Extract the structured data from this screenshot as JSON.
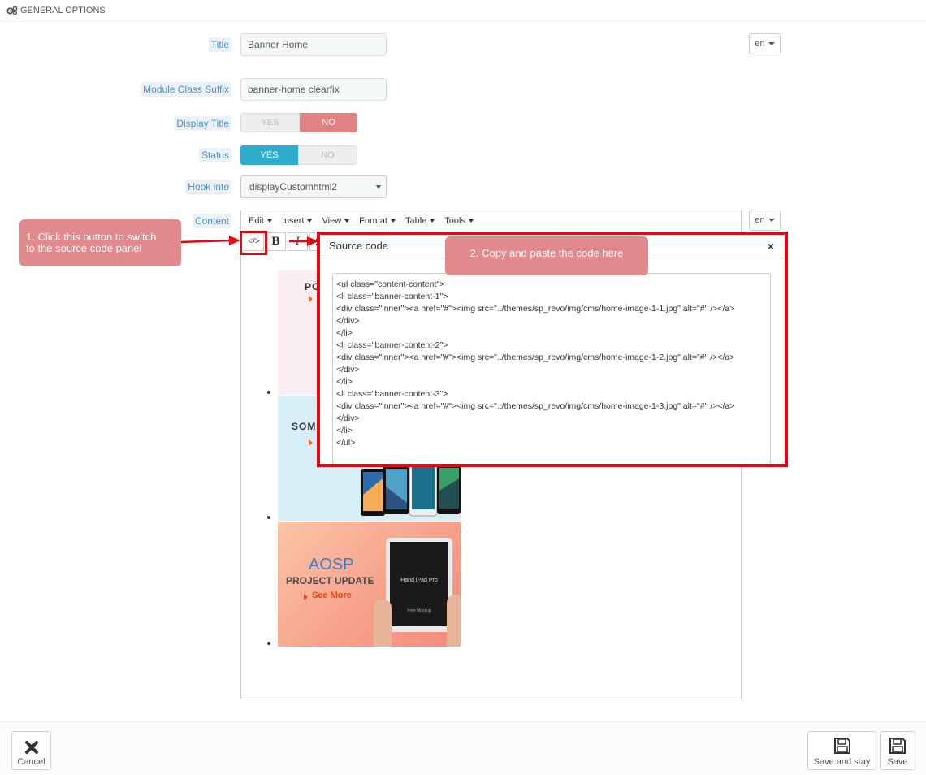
{
  "header": {
    "title": "GENERAL OPTIONS"
  },
  "form": {
    "title_label": "Title",
    "title_value": "Banner Home",
    "lang": "en",
    "suffix_label": "Module Class Suffix",
    "suffix_value": "banner-home clearfix",
    "display_title_label": "Display Title",
    "display_title_yes": "YES",
    "display_title_no": "NO",
    "status_label": "Status",
    "status_yes": "YES",
    "status_no": "NO",
    "hook_label": "Hook into",
    "hook_value": "displayCustomhtml2",
    "content_label": "Content",
    "content_lang": "en"
  },
  "editor": {
    "menu": [
      "Edit",
      "Insert",
      "View",
      "Format",
      "Table",
      "Tools"
    ],
    "source_button": "</>",
    "bold_button": "B",
    "italic_button": "I",
    "banners": [
      {
        "line1": "PO",
        "line2": ""
      },
      {
        "line1": "SOM",
        "line2": ""
      },
      {
        "line1": "AOSP",
        "line2": "PROJECT UPDATE",
        "link": "See More",
        "device": "Hand iPad Pro",
        "device_sub": "Free Mockup"
      }
    ]
  },
  "modal": {
    "title": "Source code",
    "close": "×",
    "code": "<ul class=\"content-content\">\n<li class=\"banner-content-1\">\n<div class=\"inner\"><a href=\"#\"><img src=\"../themes/sp_revo/img/cms/home-image-1-1.jpg\" alt=\"#\" /></a>\n</div>\n</li>\n<li class=\"banner-content-2\">\n<div class=\"inner\"><a href=\"#\"><img src=\"../themes/sp_revo/img/cms/home-image-1-2.jpg\" alt=\"#\" /></a>\n</div>\n</li>\n<li class=\"banner-content-3\">\n<div class=\"inner\"><a href=\"#\"><img src=\"../themes/sp_revo/img/cms/home-image-1-3.jpg\" alt=\"#\" /></a>\n</div>\n</li>\n</ul>"
  },
  "annotations": {
    "step1": "1. Click this button to switch\nto the source code panel",
    "step2": "2. Copy and paste the code here"
  },
  "footer": {
    "cancel": "Cancel",
    "save_stay": "Save and stay",
    "save": "Save"
  },
  "colors": {
    "accent_red": "#e30613",
    "callout": "#e08a8e",
    "yes_on": "#2eacce",
    "no_on": "#e08283"
  }
}
